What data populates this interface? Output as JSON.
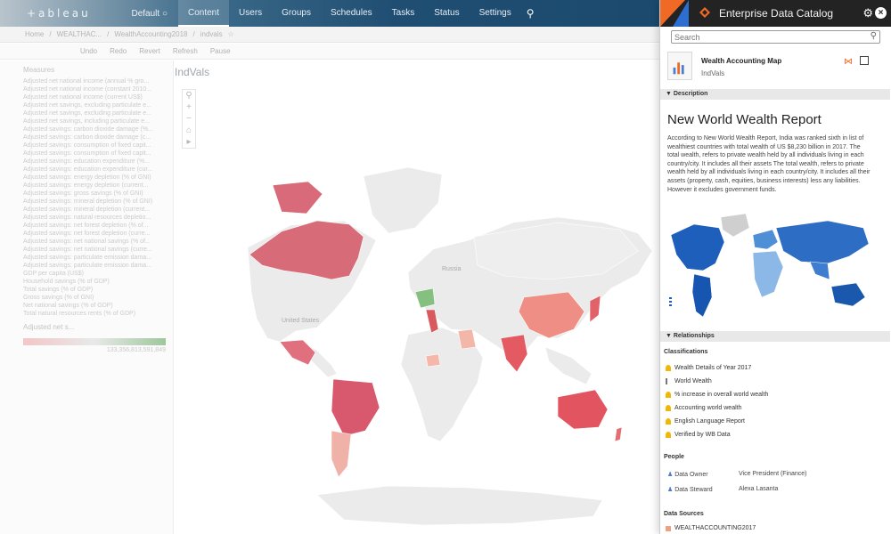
{
  "topnav": {
    "logo": "+ableau",
    "site": "Default",
    "tabs": [
      "Content",
      "Users",
      "Groups",
      "Schedules",
      "Tasks",
      "Status",
      "Settings"
    ],
    "active_tab": "Content"
  },
  "crumbs": {
    "items": [
      "Home",
      "WEALTHAC...",
      "WealthAccounting2018",
      "indvals"
    ]
  },
  "toolbar": {
    "items": [
      "Undo",
      "Redo",
      "Revert",
      "Refresh",
      "Pause"
    ]
  },
  "sheet": {
    "title": "IndVals",
    "map_labels": {
      "russia": "Russia",
      "united_states": "United States"
    }
  },
  "leftpane": {
    "section": "Measures",
    "measures": [
      "Adjusted net national income (annual % gro...",
      "Adjusted net national income (constant 2010...",
      "Adjusted net national income (current US$)",
      "Adjusted net savings, excluding particulate e...",
      "Adjusted net savings, excluding particulate e...",
      "Adjusted net savings, including particulate e...",
      "Adjusted savings: carbon dioxide damage (%...",
      "Adjusted savings: carbon dioxide damage (c...",
      "Adjusted savings: consumption of fixed capit...",
      "Adjusted savings: consumption of fixed capit...",
      "Adjusted savings: education expenditure (%...",
      "Adjusted savings: education expenditure (cur...",
      "Adjusted savings: energy depletion (% of GNI)",
      "Adjusted savings: energy depletion (current...",
      "Adjusted savings: gross savings (% of GNI)",
      "Adjusted savings: mineral depletion (% of GNI)",
      "Adjusted savings: mineral depletion (current...",
      "Adjusted savings: natural resources depletio...",
      "Adjusted savings: net forest depletion (% of...",
      "Adjusted savings: net forest depletion (curre...",
      "Adjusted savings: net national savings (% of...",
      "Adjusted savings: net national savings (curre...",
      "Adjusted savings: particulate emission dama...",
      "Adjusted savings: particulate emission dama...",
      "GDP per capita (US$)",
      "Household savings (% of GDP)",
      "Total savings (% of GDP)",
      "Gross savings (% of GNI)",
      "Net national savings (% of GDP)",
      "Total natural resources rents (% of GDP)"
    ],
    "legend_label": "Adjusted net s...",
    "legend_min": "",
    "legend_max": "133,356,813,591,849"
  },
  "catalog": {
    "title": "Enterprise Data Catalog",
    "search_placeholder": "Search",
    "asset_name": "Wealth Accounting Map",
    "asset_sub": "IndVals",
    "description_label": "Description",
    "description_title": "New World Wealth Report",
    "description_text": "According to New World Wealth Report, India was ranked sixth in list of wealthiest countries with total wealth of US $8,230 billion in 2017. The total wealth, refers to private wealth held by all individuals living in each country/city. It includes all their assets The total wealth, refers to private wealth held by all individuals living in each country/city. It includes all their assets (property, cash, equities, business interests) less any liabilities. However it excludes government funds.",
    "relationships_label": "Relationships",
    "classifications_label": "Classifications",
    "classifications": [
      "Wealth Details of Year 2017",
      "World Wealth",
      "% increase in overall world wealth",
      "Accounting world wealth",
      "English Language Report",
      "Verified by WB Data"
    ],
    "people_label": "People",
    "people": [
      {
        "role": "Data Owner",
        "name": "Vice President (Finance)"
      },
      {
        "role": "Data Steward",
        "name": "Alexa Lasanta"
      }
    ],
    "data_sources_label": "Data Sources",
    "data_sources": [
      "WEALTHACCOUNTING2017"
    ],
    "colors": {
      "accent": "#f06925",
      "brand_blue": "#2c6fd1",
      "header": "#232323"
    }
  }
}
